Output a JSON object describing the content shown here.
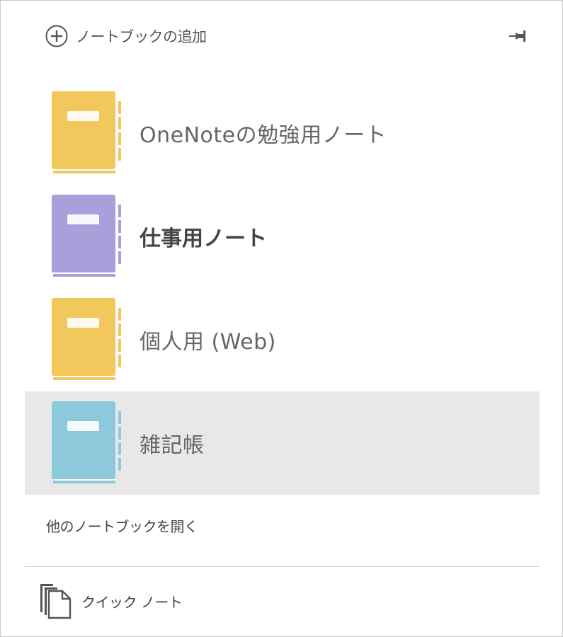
{
  "header": {
    "add_notebook_label": "ノートブックの追加",
    "add_icon": "plus-circle-icon",
    "pin_icon": "pin-icon"
  },
  "notebooks": [
    {
      "name": "OneNoteの勉強用ノート",
      "color": "#f2c75c",
      "bold": false,
      "selected": false
    },
    {
      "name": "仕事用ノート",
      "color": "#a99fdb",
      "bold": true,
      "selected": false
    },
    {
      "name": "個人用 (Web)",
      "color": "#f2c75c",
      "bold": false,
      "selected": false
    },
    {
      "name": "雑記帳",
      "color": "#8ccadb",
      "bold": false,
      "selected": true
    }
  ],
  "footer": {
    "open_other_label": "他のノートブックを開く",
    "quick_note_label": "クイック ノート",
    "quick_note_icon": "pages-icon"
  },
  "colors": {
    "selected_background": "#e8e8e8",
    "divider": "#d6d6d6"
  }
}
